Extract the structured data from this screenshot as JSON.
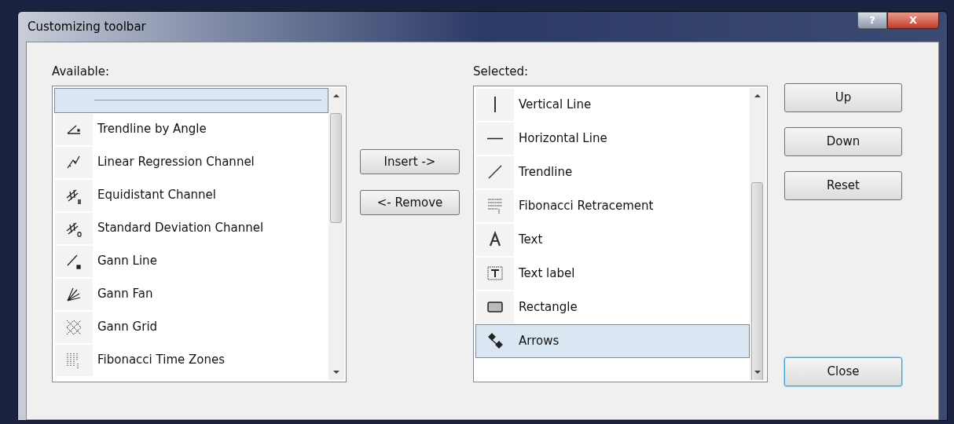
{
  "window": {
    "title": "Customizing toolbar",
    "help_button": "?",
    "close_button": "X"
  },
  "available": {
    "label": "Available:",
    "items": [
      {
        "kind": "separator",
        "selected": true
      },
      {
        "kind": "tool",
        "label": "Trendline by Angle",
        "selected": false
      },
      {
        "kind": "tool",
        "label": "Linear Regression Channel",
        "selected": false
      },
      {
        "kind": "tool",
        "label": "Equidistant Channel",
        "selected": false
      },
      {
        "kind": "tool",
        "label": "Standard Deviation Channel",
        "selected": false
      },
      {
        "kind": "tool",
        "label": "Gann Line",
        "selected": false
      },
      {
        "kind": "tool",
        "label": "Gann Fan",
        "selected": false
      },
      {
        "kind": "tool",
        "label": "Gann Grid",
        "selected": false
      },
      {
        "kind": "tool",
        "label": "Fibonacci Time Zones",
        "selected": false
      }
    ]
  },
  "middle_buttons": [
    "Insert ->",
    "<- Remove"
  ],
  "selected_list": {
    "label": "Selected:",
    "items": [
      {
        "kind": "tool",
        "label": "Vertical Line",
        "selected": false
      },
      {
        "kind": "tool",
        "label": "Horizontal Line",
        "selected": false
      },
      {
        "kind": "tool",
        "label": "Trendline",
        "selected": false
      },
      {
        "kind": "tool",
        "label": "Fibonacci Retracement",
        "selected": false
      },
      {
        "kind": "tool",
        "label": "Text",
        "selected": false
      },
      {
        "kind": "tool",
        "label": "Text label",
        "selected": false
      },
      {
        "kind": "tool",
        "label": "Rectangle",
        "selected": false
      },
      {
        "kind": "tool",
        "label": "Arrows",
        "selected": true
      }
    ]
  },
  "side_buttons": [
    {
      "label": "Up",
      "default": false
    },
    {
      "label": "Down",
      "default": false
    },
    {
      "label": "Reset",
      "default": false
    },
    {
      "label": "Close",
      "default": true
    }
  ]
}
